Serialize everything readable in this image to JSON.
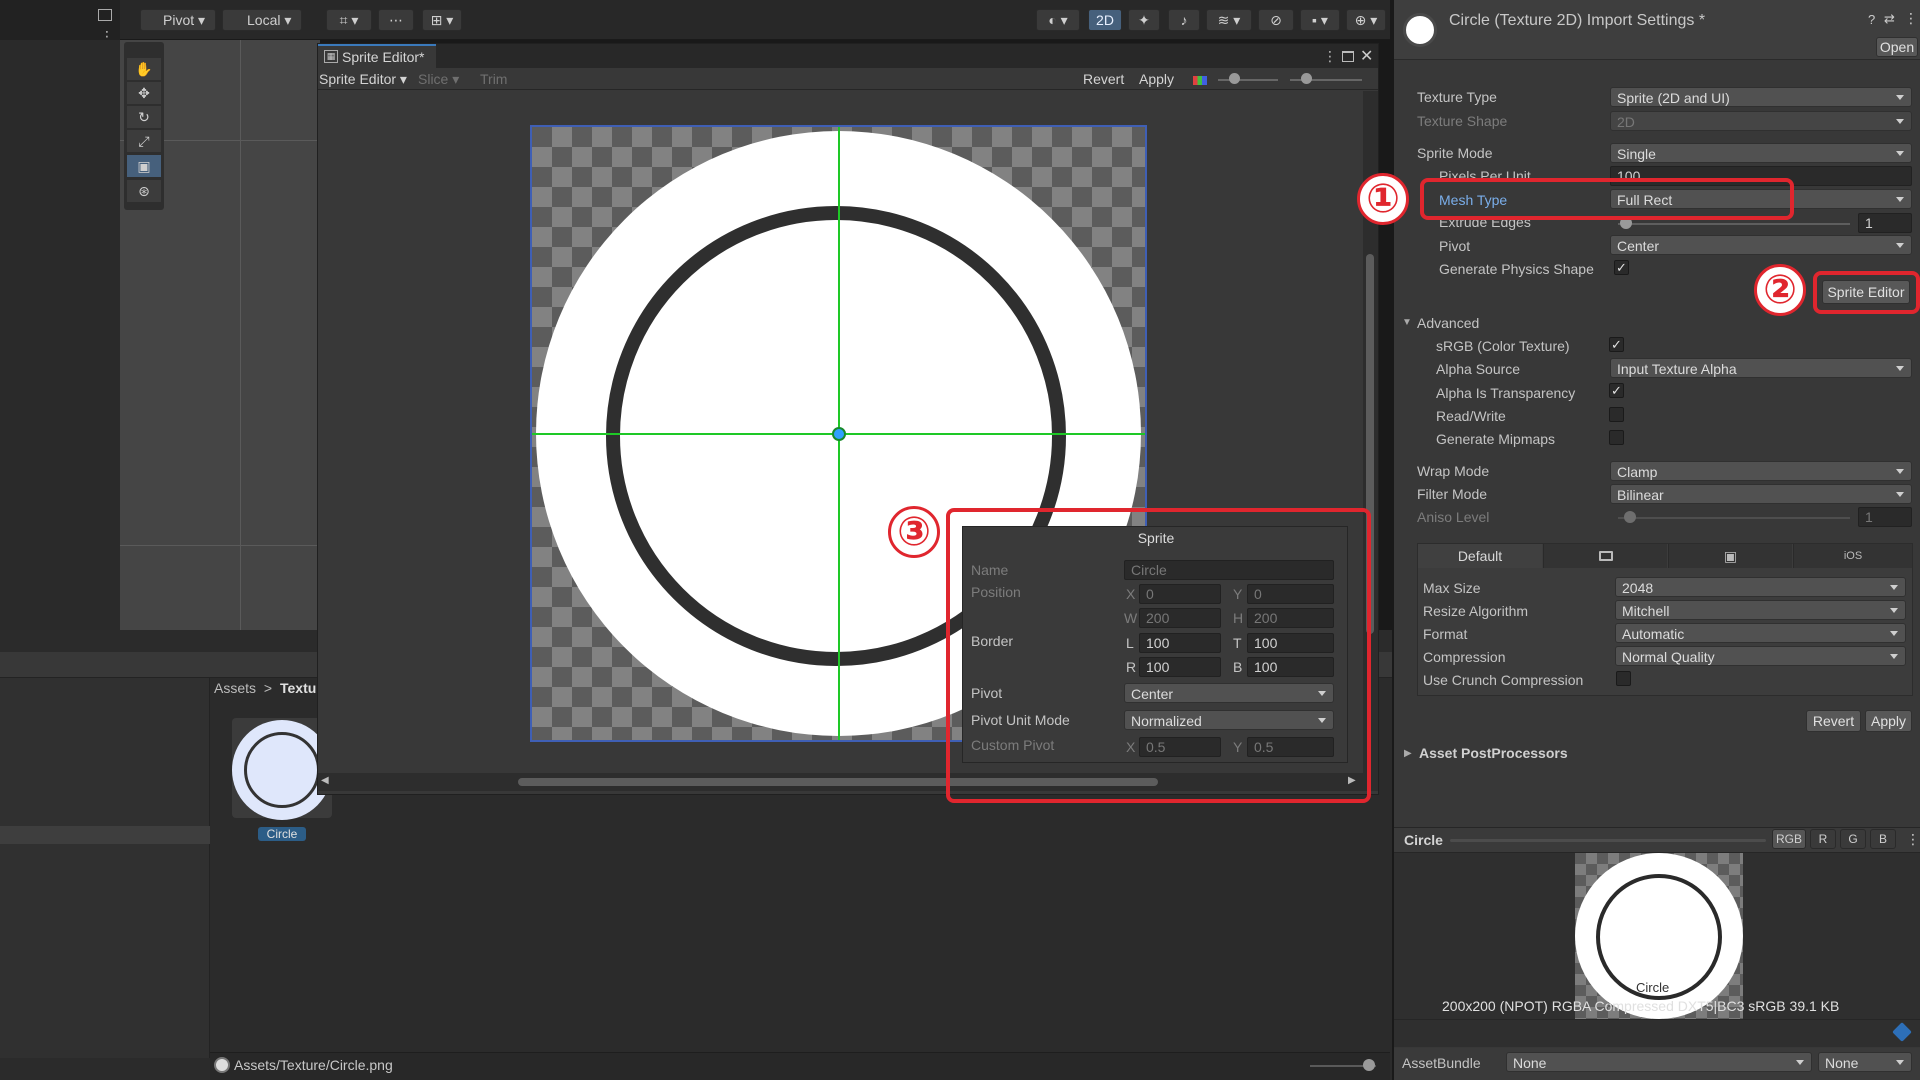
{
  "toolbar": {
    "pivot": "Pivot",
    "local": "Local",
    "two_d": "2D"
  },
  "sprite_editor": {
    "title": "Sprite Editor*",
    "menu": "Sprite Editor",
    "slice": "Slice",
    "trim": "Trim",
    "revert": "Revert",
    "apply": "Apply",
    "panel": {
      "title": "Sprite",
      "name_label": "Name",
      "name_value": "Circle",
      "position_label": "Position",
      "pos_x": "0",
      "pos_y": "0",
      "pos_w": "200",
      "pos_h": "200",
      "border_label": "Border",
      "border_l": "100",
      "border_t": "100",
      "border_r": "100",
      "border_b": "100",
      "pivot_label": "Pivot",
      "pivot_value": "Center",
      "unit_label": "Pivot Unit Mode",
      "unit_value": "Normalized",
      "custom_label": "Custom Pivot",
      "custom_x": "0.5",
      "custom_y": "0.5",
      "letters": {
        "x": "X",
        "y": "Y",
        "w": "W",
        "h": "H",
        "l": "L",
        "t": "T",
        "r": "R",
        "b": "B"
      }
    }
  },
  "project": {
    "breadcrumb_root": "Assets",
    "breadcrumb_sep": ">",
    "breadcrumb_child": "Textu",
    "asset_name": "Circle",
    "status_path": "Assets/Texture/Circle.png"
  },
  "inspector": {
    "title": "Circle (Texture 2D) Import Settings *",
    "open": "Open",
    "texture_type_label": "Texture Type",
    "texture_type": "Sprite (2D and UI)",
    "texture_shape_label": "Texture Shape",
    "texture_shape": "2D",
    "sprite_mode_label": "Sprite Mode",
    "sprite_mode": "Single",
    "ppu_label": "Pixels Per Unit",
    "ppu_value": "100",
    "mesh_type_label": "Mesh Type",
    "mesh_type": "Full Rect",
    "extrude_label": "Extrude Edges",
    "extrude_value": "1",
    "pivot_label": "Pivot",
    "pivot_value": "Center",
    "physics_label": "Generate Physics Shape",
    "sprite_editor_button": "Sprite Editor",
    "advanced": "Advanced",
    "srgb_label": "sRGB (Color Texture)",
    "alpha_source_label": "Alpha Source",
    "alpha_source": "Input Texture Alpha",
    "alpha_transp_label": "Alpha Is Transparency",
    "readwrite_label": "Read/Write",
    "mipmaps_label": "Generate Mipmaps",
    "wrap_label": "Wrap Mode",
    "wrap_value": "Clamp",
    "filter_label": "Filter Mode",
    "filter_value": "Bilinear",
    "aniso_label": "Aniso Level",
    "aniso_value": "1",
    "tabs": {
      "default": "Default",
      "ios": "iOS"
    },
    "max_size_label": "Max Size",
    "max_size": "2048",
    "resize_label": "Resize Algorithm",
    "resize_value": "Mitchell",
    "format_label": "Format",
    "format_value": "Automatic",
    "compression_label": "Compression",
    "compression_value": "Normal Quality",
    "crunch_label": "Use Crunch Compression",
    "revert": "Revert",
    "apply": "Apply",
    "postprocessors": "Asset PostProcessors",
    "preview_title": "Circle",
    "channels": {
      "rgb": "RGB",
      "r": "R",
      "g": "G",
      "b": "B"
    },
    "preview_caption": "Circle",
    "preview_info": "200x200 (NPOT)  RGBA Compressed DXT5|BC3 sRGB   39.1 KB",
    "assetbundle_label": "AssetBundle",
    "assetbundle_value": "None",
    "assetbundle_variant": "None"
  },
  "annotations": {
    "one": "①",
    "two": "②",
    "three": "③"
  }
}
